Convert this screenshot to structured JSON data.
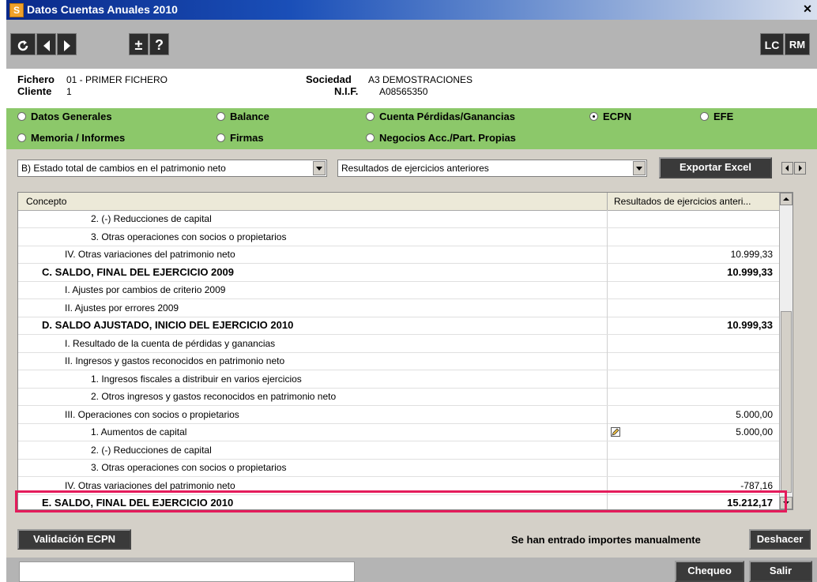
{
  "window": {
    "title": "Datos Cuentas Anuales 2010",
    "app_letter": "S",
    "close_glyph": "✕"
  },
  "toolbar": {
    "plusminus": "±",
    "help": "?",
    "lc": "LC",
    "rm": "RM"
  },
  "info": {
    "fichero_label": "Fichero",
    "fichero_value": "01 - PRIMER FICHERO",
    "cliente_label": "Cliente",
    "cliente_value": "1",
    "sociedad_label": "Sociedad",
    "sociedad_value": "A3 DEMOSTRACIONES",
    "nif_label": "N.I.F.",
    "nif_value": "A08565350"
  },
  "sections": [
    {
      "label": "Datos Generales",
      "selected": false
    },
    {
      "label": "Balance",
      "selected": false
    },
    {
      "label": "Cuenta Pérdidas/Ganancias",
      "selected": false
    },
    {
      "label": "ECPN",
      "selected": true
    },
    {
      "label": "EFE",
      "selected": false
    },
    {
      "label": "Memoria / Informes",
      "selected": false
    },
    {
      "label": "Firmas",
      "selected": false
    },
    {
      "label": "Negocios Acc./Part. Propias",
      "selected": false
    }
  ],
  "filters": {
    "statement": "B) Estado total de cambios en el patrimonio neto",
    "column": "Resultados de ejercicios anteriores",
    "export_label": "Exportar Excel"
  },
  "grid": {
    "col_concept": "Concepto",
    "col_value": "Resultados de ejercicios anteri...",
    "rows": [
      {
        "concept": "2. (-) Reducciones de capital",
        "value": "",
        "level": 3,
        "bold": false
      },
      {
        "concept": "3. Otras operaciones con socios o propietarios",
        "value": "",
        "level": 3,
        "bold": false
      },
      {
        "concept": "IV. Otras variaciones del patrimonio neto",
        "value": "10.999,33",
        "level": 2,
        "bold": false
      },
      {
        "concept": "C. SALDO, FINAL DEL EJERCICIO 2009",
        "value": "10.999,33",
        "level": 1,
        "bold": true
      },
      {
        "concept": "I. Ajustes por cambios de criterio 2009",
        "value": "",
        "level": 2,
        "bold": false
      },
      {
        "concept": "II. Ajustes por errores 2009",
        "value": "",
        "level": 2,
        "bold": false
      },
      {
        "concept": "D. SALDO AJUSTADO, INICIO DEL EJERCICIO 2010",
        "value": "10.999,33",
        "level": 1,
        "bold": true
      },
      {
        "concept": "I. Resultado de la cuenta de pérdidas y ganancias",
        "value": "",
        "level": 2,
        "bold": false
      },
      {
        "concept": "II. Ingresos y gastos reconocidos en patrimonio neto",
        "value": "",
        "level": 2,
        "bold": false
      },
      {
        "concept": "1. Ingresos fiscales a distribuir en varios ejercicios",
        "value": "",
        "level": 3,
        "bold": false
      },
      {
        "concept": "2. Otros ingresos y gastos reconocidos en patrimonio neto",
        "value": "",
        "level": 3,
        "bold": false
      },
      {
        "concept": "III. Operaciones con socios o propietarios",
        "value": "5.000,00",
        "level": 2,
        "bold": false
      },
      {
        "concept": "1. Aumentos de capital",
        "value": "5.000,00",
        "level": 3,
        "bold": false,
        "edited": true
      },
      {
        "concept": "2. (-) Reducciones de capital",
        "value": "",
        "level": 3,
        "bold": false
      },
      {
        "concept": "3. Otras operaciones con socios o propietarios",
        "value": "",
        "level": 3,
        "bold": false
      },
      {
        "concept": "IV. Otras variaciones del patrimonio neto",
        "value": "-787,16",
        "level": 2,
        "bold": false
      },
      {
        "concept": "E. SALDO, FINAL DEL EJERCICIO 2010",
        "value": "15.212,17",
        "level": 1,
        "bold": true
      }
    ]
  },
  "footer": {
    "validate_label": "Validación ECPN",
    "manual_msg": "Se han entrado importes manualmente",
    "undo_label": "Deshacer",
    "check_label": "Chequeo",
    "exit_label": "Salir"
  }
}
